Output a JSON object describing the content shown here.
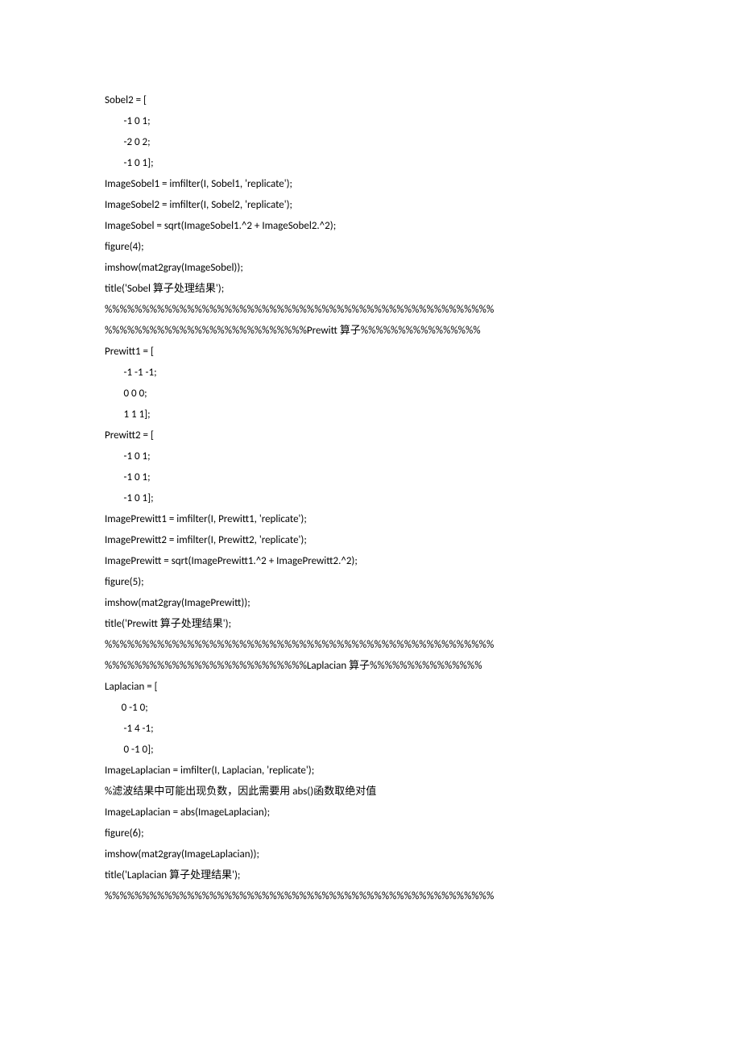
{
  "lines": [
    "Sobel2 = [",
    "        -1 0 1;",
    "        -2 0 2;",
    "        -1 0 1];",
    "ImageSobel1 = imfilter(I, Sobel1, 'replicate');",
    "ImageSobel2 = imfilter(I, Sobel2, 'replicate');",
    "",
    "ImageSobel = sqrt(ImageSobel1.^2 + ImageSobel2.^2);",
    "",
    "figure(4);",
    "imshow(mat2gray(ImageSobel));",
    "title('Sobel 算子处理结果');",
    "%%%%%%%%%%%%%%%%%%%%%%%%%%%%%%%%%%%%%%%%%%%%%%%%%%%%",
    "%%%%%%%%%%%%%%%%%%%%%%%%%%%Prewitt 算子%%%%%%%%%%%%%%%%",
    "Prewitt1 = [",
    "        -1 -1 -1;",
    "        0 0 0;",
    "        1 1 1];",
    "Prewitt2 = [",
    "        -1 0 1;",
    "        -1 0 1;",
    "        -1 0 1];",
    "ImagePrewitt1 = imfilter(I, Prewitt1, 'replicate');",
    "ImagePrewitt2 = imfilter(I, Prewitt2, 'replicate');",
    "",
    "ImagePrewitt = sqrt(ImagePrewitt1.^2 + ImagePrewitt2.^2);",
    "",
    "figure(5);",
    "imshow(mat2gray(ImagePrewitt));",
    "title('Prewitt 算子处理结果');",
    "%%%%%%%%%%%%%%%%%%%%%%%%%%%%%%%%%%%%%%%%%%%%%%%%%%%%",
    "%%%%%%%%%%%%%%%%%%%%%%%%%%%Laplacian 算子%%%%%%%%%%%%%%%",
    "Laplacian = [",
    "       0 -1 0;",
    "        -1 4 -1;",
    "        0 -1 0];",
    "ImageLaplacian = imfilter(I, Laplacian, 'replicate');",
    "%滤波结果中可能出现负数，因此需要用 abs()函数取绝对值",
    "ImageLaplacian = abs(ImageLaplacian);",
    "",
    "figure(6);",
    "imshow(mat2gray(ImageLaplacian));",
    "title('Laplacian 算子处理结果');",
    "%%%%%%%%%%%%%%%%%%%%%%%%%%%%%%%%%%%%%%%%%%%%%%%%%%%%"
  ]
}
